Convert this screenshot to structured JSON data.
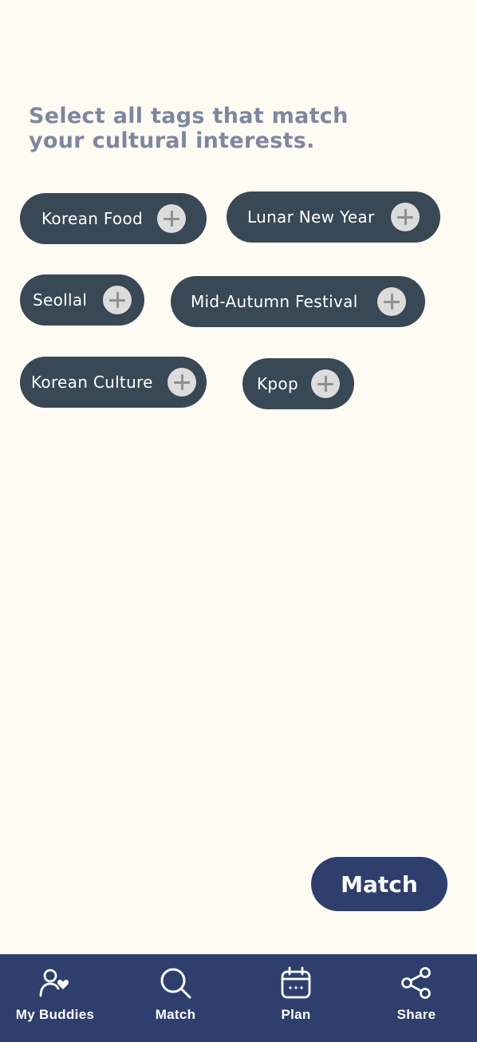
{
  "prompt": {
    "line1": "Select all tags that match",
    "line2": "your cultural interests."
  },
  "tags": [
    {
      "label": "Korean Food"
    },
    {
      "label": "Lunar New Year"
    },
    {
      "label": "Seollal"
    },
    {
      "label": "Mid-Autumn Festival"
    },
    {
      "label": "Korean Culture"
    },
    {
      "label": "Kpop"
    }
  ],
  "match_button": {
    "label": "Match"
  },
  "nav": {
    "items": [
      {
        "label": "My Buddies",
        "icon": "person-heart-icon"
      },
      {
        "label": "Match",
        "icon": "search-icon"
      },
      {
        "label": "Plan",
        "icon": "calendar-icon"
      },
      {
        "label": "Share",
        "icon": "share-icon"
      }
    ]
  },
  "colors": {
    "background": "#fefbf3",
    "tag_bg": "#384855",
    "prompt_text": "#7d87a0",
    "accent": "#2e3f6e",
    "plus_bg": "#dcdcdc"
  }
}
